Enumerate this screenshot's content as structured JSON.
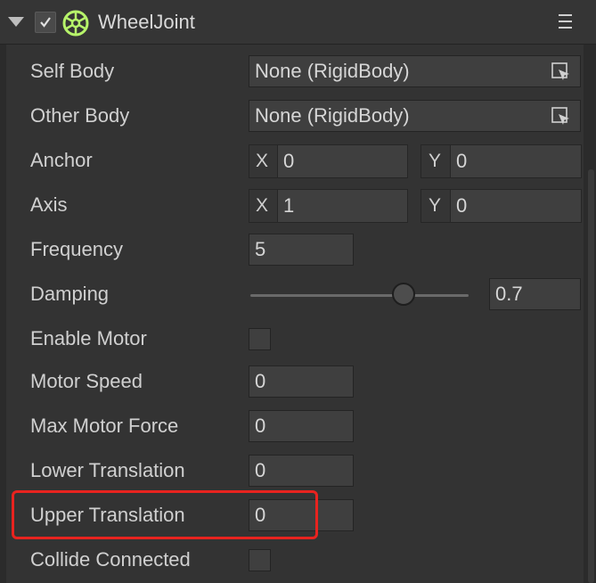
{
  "component": {
    "title": "WheelJoint",
    "enabled": true,
    "icon": "wheel-icon",
    "accent_color": "#b6f36a",
    "menu_icon": "hamburger-menu-icon"
  },
  "properties": {
    "self_body": {
      "label": "Self Body",
      "value": "None (RigidBody)"
    },
    "other_body": {
      "label": "Other Body",
      "value": "None (RigidBody)"
    },
    "anchor": {
      "label": "Anchor",
      "x_label": "X",
      "x": "0",
      "y_label": "Y",
      "y": "0"
    },
    "axis": {
      "label": "Axis",
      "x_label": "X",
      "x": "1",
      "y_label": "Y",
      "y": "0"
    },
    "frequency": {
      "label": "Frequency",
      "value": "5"
    },
    "damping": {
      "label": "Damping",
      "value": "0.7",
      "slider_fraction": 0.7
    },
    "enable_motor": {
      "label": "Enable Motor",
      "checked": false
    },
    "motor_speed": {
      "label": "Motor Speed",
      "value": "0"
    },
    "max_motor_force": {
      "label": "Max Motor Force",
      "value": "0"
    },
    "lower_translation": {
      "label": "Lower Translation",
      "value": "0"
    },
    "upper_translation": {
      "label": "Upper Translation",
      "value": "0"
    },
    "collide_connected": {
      "label": "Collide Connected",
      "checked": false
    }
  },
  "highlight_color": "#e8231f"
}
